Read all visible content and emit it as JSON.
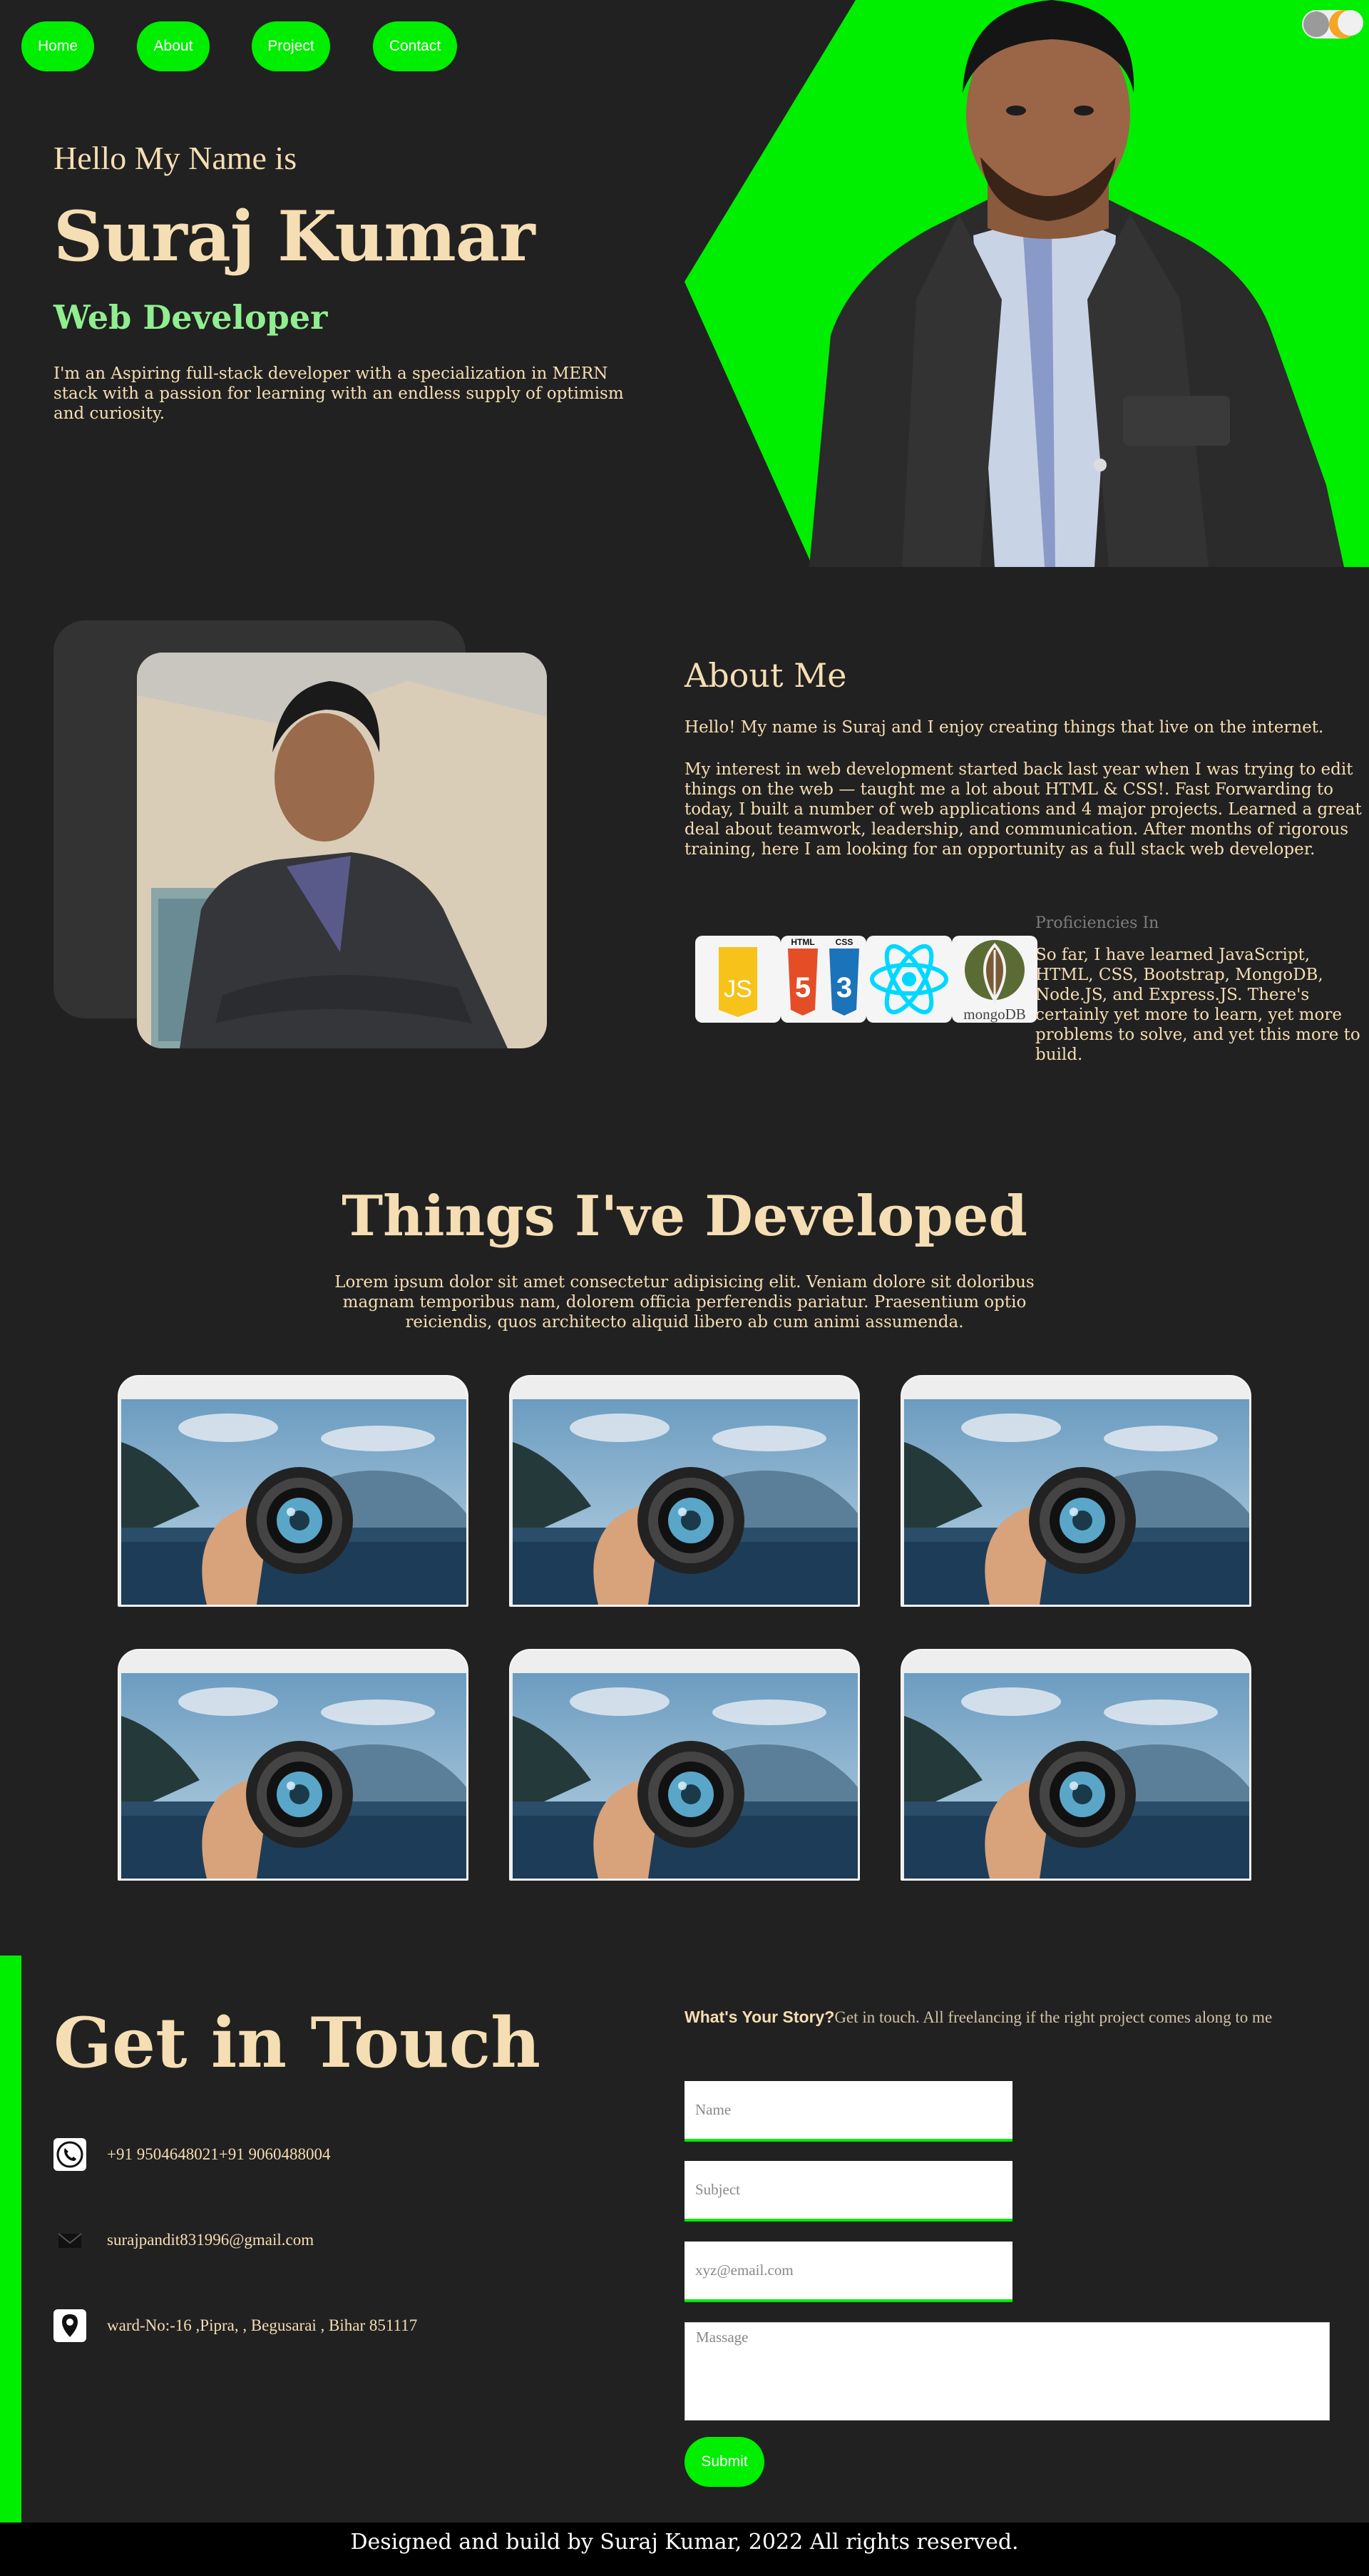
{
  "nav": {
    "items": [
      "Home",
      "About",
      "Project",
      "Contact"
    ]
  },
  "colors": {
    "background": "#212121",
    "accent_green": "#00ee00",
    "text_wheat": "#f5deb3",
    "role_green": "#90ee90",
    "footer": "#000000"
  },
  "hero": {
    "greeting": "Hello My Name is",
    "name": "Suraj Kumar",
    "role": "Web Developer",
    "description": "I'm an Aspiring full-stack developer with a specialization in MERN stack with a passion for learning with an endless supply of optimism and curiosity."
  },
  "about": {
    "title": "About Me",
    "paragraph1": "Hello! My name is Suraj and I enjoy creating things that live on the internet.",
    "paragraph2": "My interest in web development started back last year when I was trying to edit things on the web — taught me a lot about HTML & CSS!. Fast Forwarding to today, I built a number of web applications and 4 major projects. Learned a great deal about teamwork, leadership, and communication. After months of rigorous training, here I am looking for an opportunity as a full stack web developer.",
    "proficiencies_title": "Proficiencies In",
    "proficiencies_text": "So far, I have learned JavaScript, HTML, CSS, Bootstrap, MongoDB, Node.JS, and Express.JS. There's certainly yet more to learn, yet more problems to solve, and yet this more to build.",
    "tech_icons": [
      {
        "name": "javascript-icon",
        "label": "JS"
      },
      {
        "name": "html-css-icon",
        "labels": [
          "HTML",
          "CSS"
        ]
      },
      {
        "name": "react-icon"
      },
      {
        "name": "mongodb-icon",
        "label": "mongoDB"
      }
    ]
  },
  "projects": {
    "title": "Things I've Developed",
    "description": "Lorem ipsum dolor sit amet consectetur adipisicing elit. Veniam dolore sit doloribus magnam temporibus nam, dolorem officia perferendis pariatur. Praesentium optio reiciendis, quos architecto aliquid libero ab cum animi assumenda.",
    "cards": [
      {
        "image": "camera-lens-image"
      },
      {
        "image": "camera-lens-image"
      },
      {
        "image": "camera-lens-image"
      },
      {
        "image": "camera-lens-image"
      },
      {
        "image": "camera-lens-image"
      },
      {
        "image": "camera-lens-image"
      }
    ]
  },
  "contact": {
    "title": "Get in Touch",
    "phone": "+91 9504648021+91 9060488004",
    "email": "surajpandit831996@gmail.com",
    "address": "ward-No:-16 ,Pipra, , Begusarai , Bihar 851117",
    "story_bold": "What's Your Story?",
    "story_text": "Get in touch. All freelancing if the right project comes along to me",
    "form": {
      "name_placeholder": "Name",
      "subject_placeholder": "Subject",
      "email_placeholder": "xyz@email.com",
      "message_placeholder": "Massage",
      "submit_label": "Submit"
    }
  },
  "footer": {
    "text": "Designed and build by Suraj Kumar, 2022 All rights reserved."
  }
}
